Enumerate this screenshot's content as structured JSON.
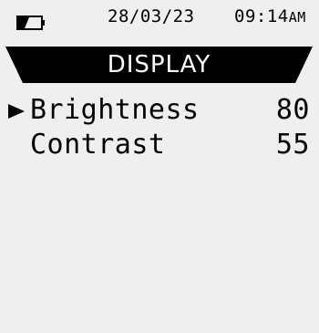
{
  "status": {
    "battery_icon": "battery-low-icon",
    "date": "28/03/23",
    "time": "09:14",
    "ampm": "AM"
  },
  "title": "DISPLAY",
  "menu": {
    "selector_icon": "selector-arrow-icon",
    "items": [
      {
        "label": "Brightness",
        "value": "80",
        "selected": true
      },
      {
        "label": "Contrast",
        "value": "55",
        "selected": false
      }
    ]
  },
  "colors": {
    "background": "#efefef",
    "banner": "#000000",
    "text": "#000000",
    "banner_text": "#ffffff"
  }
}
